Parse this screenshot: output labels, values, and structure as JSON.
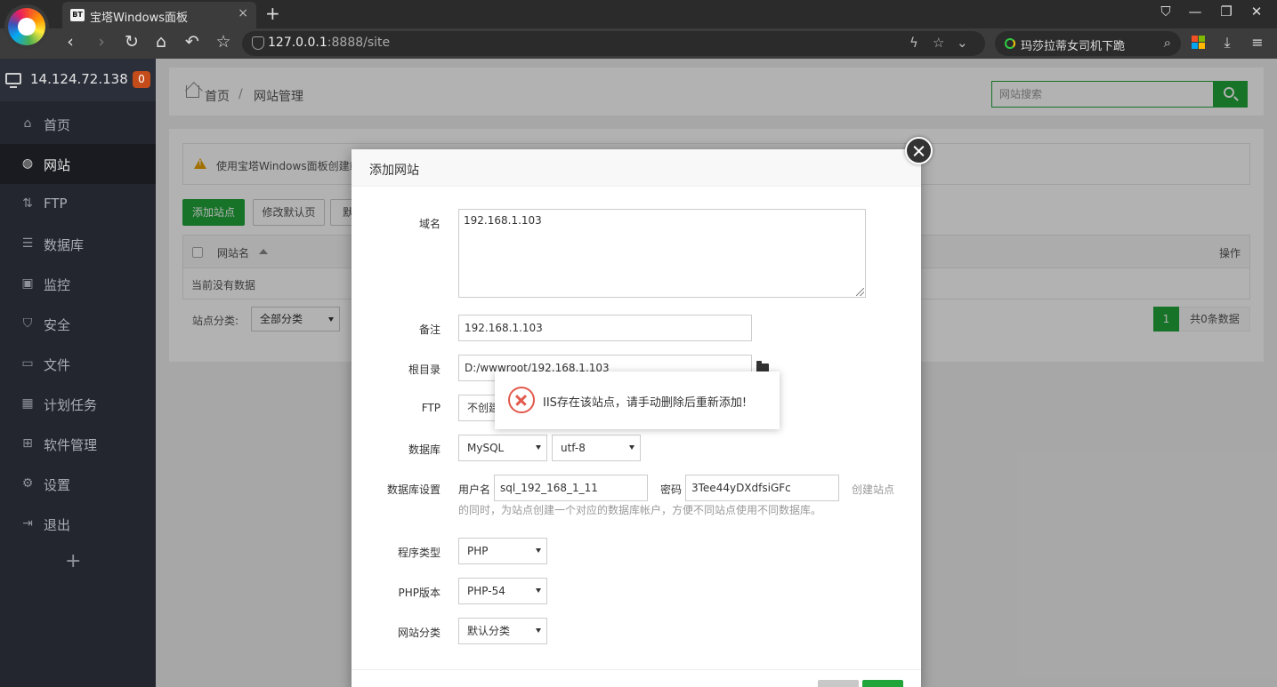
{
  "browser": {
    "tab_favicon": "BT",
    "tab_title": "宝塔Windows面板",
    "tab_close": "×",
    "new_tab": "+",
    "url_host": "127.0.0.1",
    "url_rest": ":8888/site",
    "search_text": "玛莎拉蒂女司机下跪",
    "icons": {
      "back": "back-icon",
      "forward": "forward-icon",
      "refresh": "refresh-icon",
      "home": "home-icon",
      "undo": "undo-icon",
      "favorite": "star-icon",
      "lightning": "lightning-icon",
      "down": "chevron-down-icon",
      "download": "download-icon",
      "menu": "menu-icon"
    }
  },
  "sidebar": {
    "server_ip": "14.124.72.138",
    "badge_count": "0",
    "items": [
      {
        "label": "首页",
        "icon": "home-icon",
        "active": false
      },
      {
        "label": "网站",
        "icon": "globe-icon",
        "active": true
      },
      {
        "label": "FTP",
        "icon": "ftp-icon",
        "active": false
      },
      {
        "label": "数据库",
        "icon": "database-icon",
        "active": false
      },
      {
        "label": "监控",
        "icon": "monitor-icon",
        "active": false
      },
      {
        "label": "安全",
        "icon": "shield-icon",
        "active": false
      },
      {
        "label": "文件",
        "icon": "folder-icon",
        "active": false
      },
      {
        "label": "计划任务",
        "icon": "calendar-icon",
        "active": false
      },
      {
        "label": "软件管理",
        "icon": "apps-icon",
        "active": false
      },
      {
        "label": "设置",
        "icon": "gear-icon",
        "active": false
      },
      {
        "label": "退出",
        "icon": "logout-icon",
        "active": false
      }
    ],
    "add_label": "+"
  },
  "header": {
    "breadcrumb_home": "首页",
    "breadcrumb_sep": "/",
    "breadcrumb_current": "网站管理",
    "search_placeholder": "网站搜索"
  },
  "main": {
    "notice": "使用宝塔Windows面板创建站",
    "buttons": {
      "add_site": "添加站点",
      "modify_default": "修改默认页",
      "default_site": "默"
    },
    "table": {
      "col_name": "网站名",
      "col_ops": "操作",
      "empty": "当前没有数据"
    },
    "category_label": "站点分类:",
    "category_value": "全部分类",
    "pagination": {
      "current": "1",
      "total": "共0条数据"
    }
  },
  "modal": {
    "title": "添加网站",
    "domain_label": "域名",
    "domain_value": "192.168.1.103",
    "remark_label": "备注",
    "remark_value": "192.168.1.103",
    "root_label": "根目录",
    "root_value": "D:/wwwroot/192.168.1.103",
    "ftp_label": "FTP",
    "ftp_value": "不创建",
    "db_label": "数据库",
    "db_type": "MySQL",
    "db_charset": "utf-8",
    "db_settings_label": "数据库设置",
    "db_user_label": "用户名",
    "db_user_value": "sql_192_168_1_11",
    "db_pass_label": "密码",
    "db_pass_value": "3Tee44yDXdfsiGFc",
    "db_hint_a": "创建站点",
    "db_hint_b": "的同时，为站点创建一个对应的数据库帐户，方便不同站点使用不同数据库。",
    "program_label": "程序类型",
    "program_value": "PHP",
    "php_label": "PHP版本",
    "php_value": "PHP-54",
    "category_label": "网站分类",
    "category_value": "默认分类"
  },
  "toast": {
    "message": "IIS存在该站点，请手动删除后重新添加!",
    "icon": "error-circle-icon"
  }
}
